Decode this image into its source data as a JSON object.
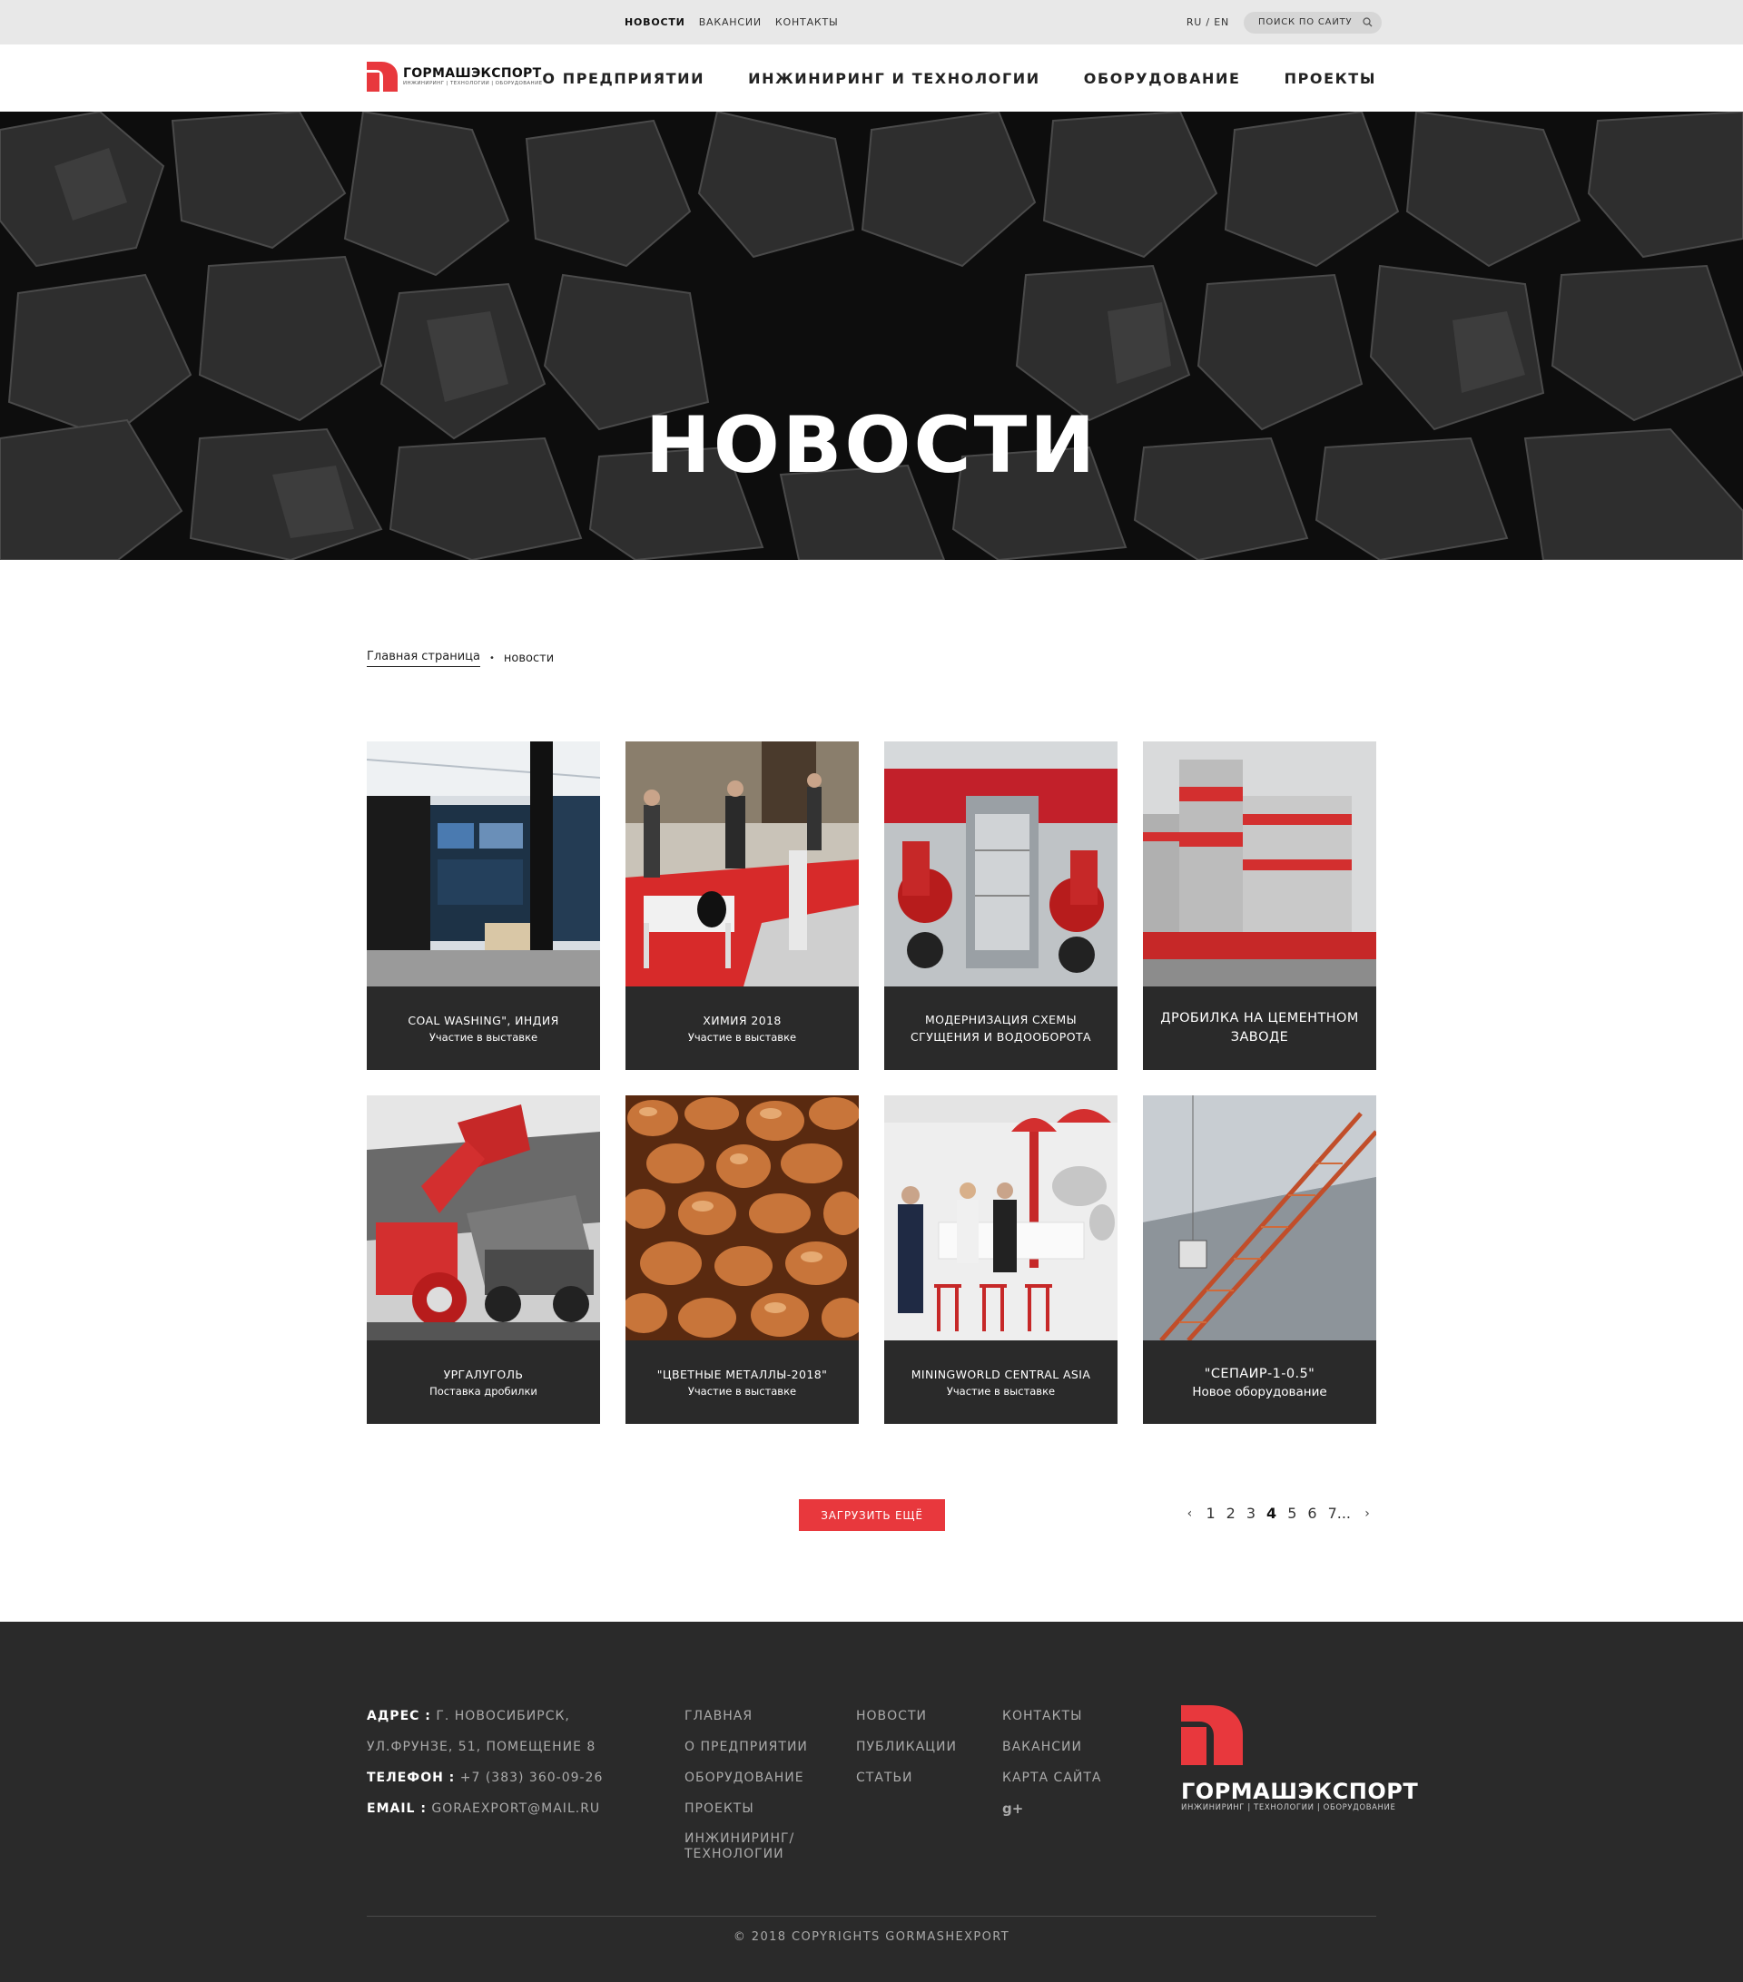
{
  "topbar": {
    "links": [
      {
        "label": "Новости"
      },
      {
        "label": "Вакансии"
      },
      {
        "label": "Контакты"
      }
    ],
    "lang": "RU / EN",
    "search_placeholder": "Поиск по сайту"
  },
  "header": {
    "logo_name": "ГОРМАШЭКСПОРТ",
    "logo_tagline": "ИНЖИНИРИНГ | ТЕХНОЛОГИИ | ОБОРУДОВАНИЕ",
    "nav": [
      {
        "label": "О предприятии"
      },
      {
        "label": "Инжиниринг и технологии"
      },
      {
        "label": "Оборудование"
      },
      {
        "label": "Проекты"
      }
    ]
  },
  "hero": {
    "title": "НОВОСТИ"
  },
  "breadcrumb": {
    "home": "Главная страница",
    "separator": "•",
    "current": "новости"
  },
  "news": [
    {
      "title": "COAL WASHING\", ИНДИЯ",
      "subtitle": "Участие в выставке"
    },
    {
      "title": "ХИМИЯ 2018",
      "subtitle": "Участие в выставке"
    },
    {
      "title": "МОДЕРНИЗАЦИЯ СХЕМЫ СГУЩЕНИЯ И ВОДООБОРОТА",
      "subtitle": ""
    },
    {
      "title": "ДРОБИЛКА НА ЦЕМЕНТНОМ ЗАВОДЕ",
      "subtitle": ""
    },
    {
      "title": "УРГАЛУГОЛЬ",
      "subtitle": "Поставка дробилки"
    },
    {
      "title": "\"ЦВЕТНЫЕ МЕТАЛЛЫ-2018\"",
      "subtitle": "Участие в выставке"
    },
    {
      "title": "MININGWORLD CENTRAL ASIA",
      "subtitle": "Участие в выставке"
    },
    {
      "title": "\"СЕПАИР-1-0.5\"",
      "subtitle": "Новое оборудование"
    }
  ],
  "load_more": "ЗАГРУЗИТЬ ЕЩЁ",
  "pagination": {
    "pages": [
      "1",
      "2",
      "3",
      "4",
      "5",
      "6",
      "7..."
    ],
    "current": "4"
  },
  "footer": {
    "address_label": "Адрес :",
    "address_line1": "г. Новосибирск,",
    "address_line2": "ул.Фрунзе, 51, помещение 8",
    "phone_label": "Телефон :",
    "phone": "+7 (383) 360-09-26",
    "email_label": "Email :",
    "email": "goraexport@mail.ru",
    "col1": [
      "Главная",
      "О предприятии",
      "Оборудование",
      "Проекты",
      "Инжиниринг/ Технологии"
    ],
    "col2": [
      "Новости",
      "Публикации",
      "Статьи"
    ],
    "col3": [
      "Контакты",
      "Вакансии",
      "Карта сайта"
    ],
    "gplus": "g+",
    "logo_name": "ГОРМАШЭКСПОРТ",
    "logo_tagline": "ИНЖИНИРИНГ | ТЕХНОЛОГИИ | ОБОРУДОВАНИЕ",
    "copyright": "© 2018 COPYRIGHTS GORMASHEXPORT"
  },
  "colors": {
    "accent": "#e8383d",
    "dark": "#2a2a2a",
    "topbar": "#e8e8e8"
  }
}
